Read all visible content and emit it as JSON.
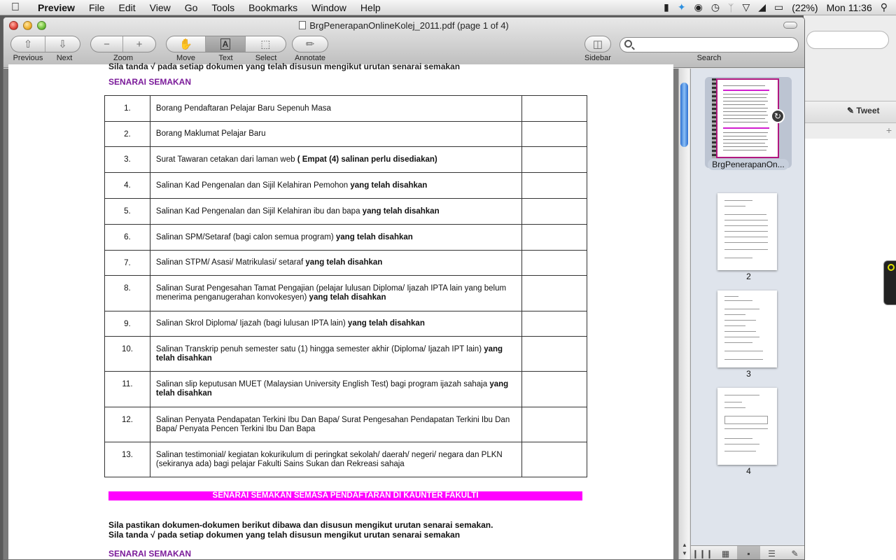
{
  "menubar": {
    "app_name": "Preview",
    "items": [
      "File",
      "Edit",
      "View",
      "Go",
      "Tools",
      "Bookmarks",
      "Window",
      "Help"
    ],
    "battery": "(22%)",
    "clock": "Mon 11:36"
  },
  "window": {
    "title": "BrgPenerapanOnlineKolej_2011.pdf (page 1 of 4)"
  },
  "toolbar": {
    "previous_label": "Previous",
    "next_label": "Next",
    "zoom_label": "Zoom",
    "zoom_out_glyph": "−",
    "zoom_in_glyph": "+",
    "move_label": "Move",
    "text_label": "Text",
    "select_label": "Select",
    "annotate_label": "Annotate",
    "sidebar_label": "Sidebar",
    "search_label": "Search",
    "search_placeholder": ""
  },
  "background_app": {
    "tweet_label": "Tweet"
  },
  "document": {
    "cut_line": "Sila tanda √ pada setiap dokumen yang telah disusun mengikut urutan senarai semakan",
    "heading": "SENARAI SEMAKAN",
    "rows": [
      {
        "num": "1.",
        "text": "Borang Pendaftaran Pelajar Baru Sepenuh Masa",
        "bold": ""
      },
      {
        "num": "2.",
        "text": "Borang Maklumat Pelajar Baru",
        "bold": ""
      },
      {
        "num": "3.",
        "text": "Surat Tawaran cetakan  dari laman web ",
        "bold": "( Empat (4) salinan perlu disediakan)"
      },
      {
        "num": "4.",
        "text": "Salinan Kad Pengenalan dan Sijil Kelahiran Pemohon ",
        "bold": "yang telah disahkan"
      },
      {
        "num": "5.",
        "text": "Salinan Kad Pengenalan dan Sijil Kelahiran ibu dan bapa ",
        "bold": "yang telah disahkan"
      },
      {
        "num": "6.",
        "text": "Salinan SPM/Setaraf (bagi calon semua program)  ",
        "bold": "yang telah disahkan"
      },
      {
        "num": "7.",
        "text": "Salinan STPM/ Asasi/ Matrikulasi/ setaraf ",
        "bold": "yang telah disahkan"
      },
      {
        "num": "8.",
        "text": "Salinan Surat Pengesahan Tamat Pengajian (pelajar lulusan Diploma/ Ijazah IPTA lain yang belum menerima penganugerahan konvokesyen) ",
        "bold": "yang telah disahkan"
      },
      {
        "num": "9.",
        "text": "Salinan Skrol Diploma/ Ijazah (bagi lulusan IPTA lain) ",
        "bold": "yang telah disahkan"
      },
      {
        "num": "10.",
        "text": "Salinan Transkrip penuh semester satu (1) hingga semester akhir (Diploma/ Ijazah IPT lain) ",
        "bold": "yang telah disahkan"
      },
      {
        "num": "11.",
        "text": "Salinan slip keputusan MUET (Malaysian University English Test) bagi program ijazah sahaja ",
        "bold": "yang telah disahkan"
      },
      {
        "num": "12.",
        "text": "Salinan Penyata Pendapatan Terkini Ibu Dan Bapa/ Surat Pengesahan Pendapatan Terkini Ibu Dan Bapa/ Penyata Pencen Terkini Ibu Dan Bapa",
        "bold": ""
      },
      {
        "num": "13.",
        "text": "Salinan testimonial/ kegiatan kokurikulum di peringkat sekolah/ daerah/ negeri/ negara dan PLKN (sekiranya ada) bagi pelajar Fakulti Sains Sukan dan Rekreasi sahaja",
        "bold": ""
      }
    ],
    "banner": "SENARAI SEMAKAN SEMASA PENDAFTARAN DI KAUNTER FAKULTI",
    "instruction_1": "Sila pastikan dokumen-dokumen berikut dibawa dan disusun mengikut urutan senarai semakan.",
    "instruction_2": "Sila tanda √ pada setiap dokumen yang telah disusun mengikut urutan senarai semakan",
    "heading_bottom": "SENARAI SEMAKAN"
  },
  "sidebar": {
    "selected_label": "BrgPenerapanOn...",
    "pages": [
      "2",
      "3",
      "4"
    ]
  },
  "colors": {
    "heading": "#7b1b9a",
    "banner": "#ff00ff",
    "thumb_selection": "#b1177f"
  }
}
